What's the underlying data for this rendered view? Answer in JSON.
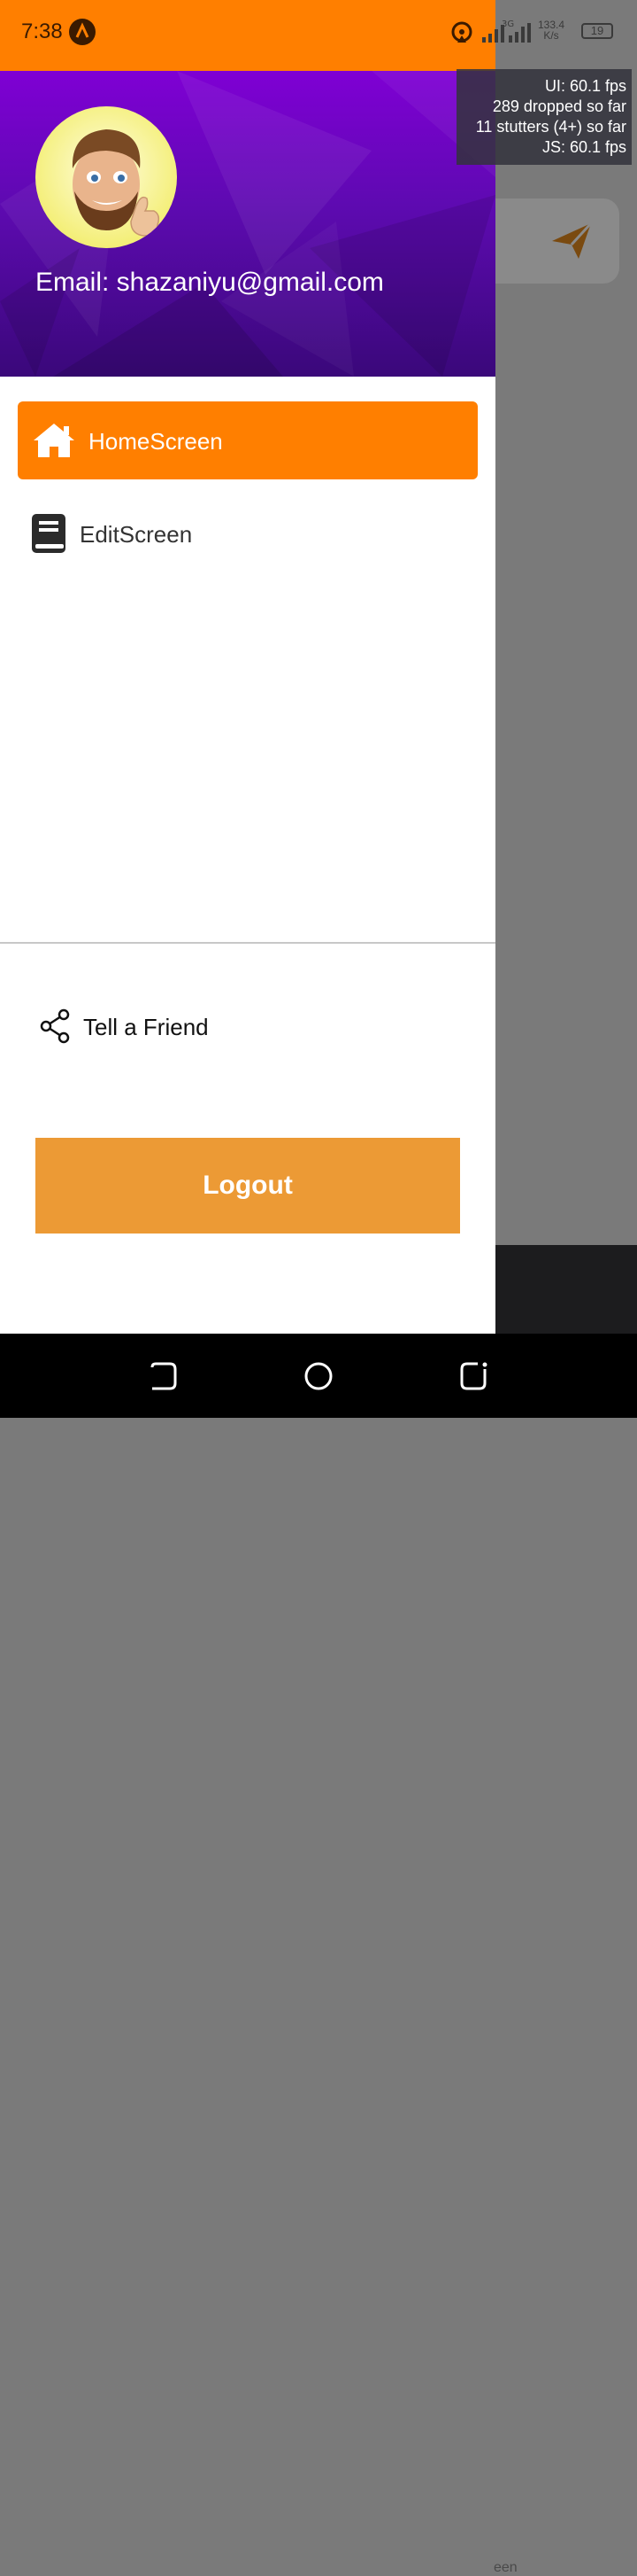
{
  "status_bar": {
    "time": "7:38",
    "network_speed_value": "133.4",
    "network_speed_unit": "K/s",
    "battery": "19"
  },
  "perf_monitor": {
    "ui_fps": "UI: 60.1 fps",
    "dropped": "289 dropped so far",
    "stutters": "11 stutters (4+) so far",
    "js_fps": "JS: 60.1 fps"
  },
  "drawer": {
    "email_label": "Email: shazaniyu@gmail.com",
    "items": [
      {
        "label": "HomeScreen",
        "icon": "home-icon",
        "active": true
      },
      {
        "label": "EditScreen",
        "icon": "book-icon",
        "active": false
      }
    ],
    "share_label": "Tell a Friend",
    "logout_label": "Logout"
  },
  "background_app": {
    "bottom_text": "een"
  },
  "colors": {
    "accent": "#ff7f00",
    "header_purple": "#7f00d4",
    "logout": "#ec9a35"
  }
}
